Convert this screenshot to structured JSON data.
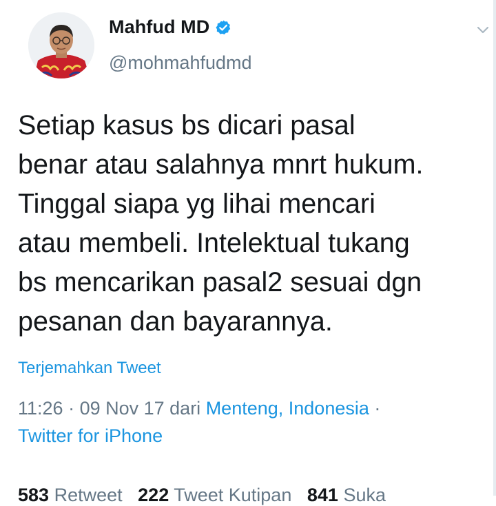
{
  "user": {
    "display_name": "Mahfud MD",
    "handle": "@mohmahfudmd",
    "verified": true
  },
  "tweet": {
    "text": "Setiap kasus bs dicari pasal\nbenar atau salahnya mnrt hukum.\nTinggal siapa yg lihai mencari\natau membeli. Intelektual tukang\nbs mencarikan pasal2 sesuai dgn\npesanan dan bayarannya.",
    "translate_label": "Terjemahkan Tweet",
    "time": "11:26",
    "sep1": " · ",
    "date": "09 Nov 17",
    "from_label": " dari ",
    "location": "Menteng, Indonesia",
    "sep2": " · ",
    "source": "Twitter for iPhone"
  },
  "stats": {
    "retweets_count": "583",
    "retweets_label": "Retweet",
    "quotes_count": "222",
    "quotes_label": "Tweet Kutipan",
    "likes_count": "841",
    "likes_label": "Suka"
  },
  "icons": {
    "verified": "verified-badge-icon",
    "menu": "chevron-down-icon"
  },
  "colors": {
    "link": "#1b95e0",
    "muted": "#657786",
    "text": "#14171a",
    "verified": "#1da1f2"
  }
}
